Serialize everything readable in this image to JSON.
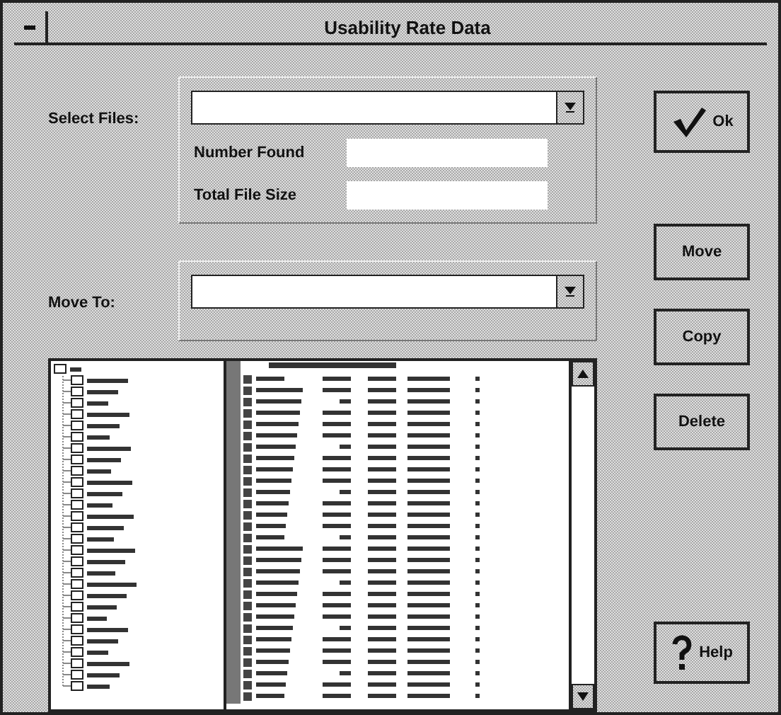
{
  "window": {
    "title": "Usability Rate Data"
  },
  "select_files": {
    "label": "Select Files:"
  },
  "number_found": {
    "label": "Number Found"
  },
  "total_file_size": {
    "label": "Total File Size"
  },
  "move_to": {
    "label": "Move To:"
  },
  "buttons": [
    {
      "label": "Ok",
      "kind": "ok"
    },
    {
      "label": "Move",
      "kind": "plain"
    },
    {
      "label": "Copy",
      "kind": "plain"
    },
    {
      "label": "Delete",
      "kind": "plain"
    },
    {
      "label": "Help",
      "kind": "help"
    }
  ]
}
